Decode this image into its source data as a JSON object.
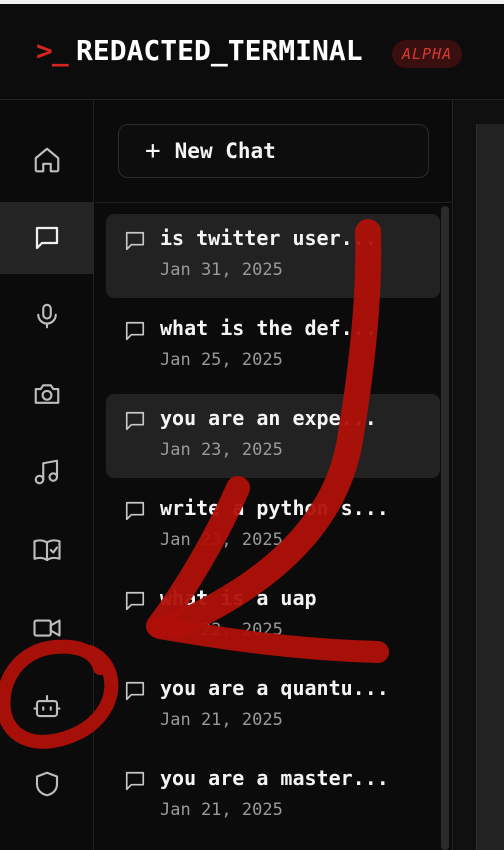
{
  "header": {
    "prompt_glyph": ">_",
    "app_title": "REDACTED_TERMINAL",
    "badge": "ALPHA"
  },
  "rail": {
    "items": [
      {
        "icon": "home-icon"
      },
      {
        "icon": "chat-icon",
        "active": true
      },
      {
        "icon": "microphone-icon"
      },
      {
        "icon": "camera-icon"
      },
      {
        "icon": "music-icon"
      },
      {
        "icon": "book-check-icon"
      },
      {
        "icon": "video-icon"
      },
      {
        "icon": "bot-icon"
      },
      {
        "icon": "shield-icon"
      }
    ]
  },
  "chat_panel": {
    "new_chat_label": "New Chat",
    "chats": [
      {
        "title": "is twitter user...",
        "date": "Jan 31, 2025",
        "highlighted": true
      },
      {
        "title": "what is the def...",
        "date": "Jan 25, 2025"
      },
      {
        "title": "you are an expe...",
        "date": "Jan 23, 2025",
        "highlighted": true
      },
      {
        "title": "write a python s...",
        "date": "Jan 23, 2025"
      },
      {
        "title": "what is a uap",
        "date": "Jan 22, 2025"
      },
      {
        "title": "you are a quantu...",
        "date": "Jan 21, 2025"
      },
      {
        "title": "you are a master...",
        "date": "Jan 21, 2025"
      }
    ]
  },
  "colors": {
    "accent_red": "#d6231f",
    "annotation_red": "#b0100a",
    "background": "#0b0b0b",
    "active_rail": "#252525"
  }
}
